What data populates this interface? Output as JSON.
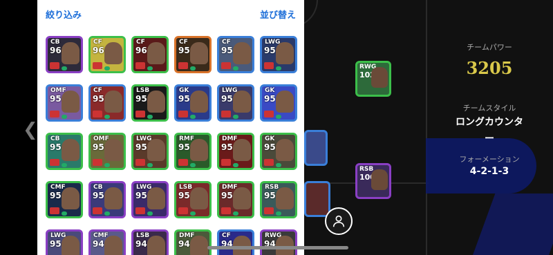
{
  "header": {
    "filter_label": "絞り込み",
    "sort_label": "並び替え"
  },
  "cards": [
    {
      "pos": "CB",
      "rating": "96",
      "border": "#8a3fc4",
      "bg": "#2d2a3a"
    },
    {
      "pos": "CF",
      "rating": "96",
      "border": "#3cbf4a",
      "bg": "#c4b43f"
    },
    {
      "pos": "CF",
      "rating": "96",
      "border": "#3cbf4a",
      "bg": "#5a1a1a"
    },
    {
      "pos": "CF",
      "rating": "95",
      "border": "#d9732a",
      "bg": "#3a2a1a"
    },
    {
      "pos": "CF",
      "rating": "95",
      "border": "#3a7fd9",
      "bg": "#4a5a7a"
    },
    {
      "pos": "LWG",
      "rating": "95",
      "border": "#3a7fd9",
      "bg": "#2a3a6a"
    },
    {
      "pos": "OMF",
      "rating": "95",
      "border": "#3a7fd9",
      "bg": "#7a5aa0"
    },
    {
      "pos": "CF",
      "rating": "95",
      "border": "#3a7fd9",
      "bg": "#8a2a2a"
    },
    {
      "pos": "LSB",
      "rating": "95",
      "border": "#3cbf4a",
      "bg": "#1a1a1a"
    },
    {
      "pos": "GK",
      "rating": "95",
      "border": "#3a7fd9",
      "bg": "#2a3a8a"
    },
    {
      "pos": "LWG",
      "rating": "95",
      "border": "#3a7fd9",
      "bg": "#3a3a6a"
    },
    {
      "pos": "GK",
      "rating": "95",
      "border": "#3a7fd9",
      "bg": "#3a4ac4"
    },
    {
      "pos": "CB",
      "rating": "95",
      "border": "#3cbf4a",
      "bg": "#2a7a6a"
    },
    {
      "pos": "OMF",
      "rating": "95",
      "border": "#3cbf4a",
      "bg": "#6a6a3a"
    },
    {
      "pos": "LWG",
      "rating": "95",
      "border": "#3cbf4a",
      "bg": "#5a3a2a"
    },
    {
      "pos": "RMF",
      "rating": "95",
      "border": "#3cbf4a",
      "bg": "#2a5a2a"
    },
    {
      "pos": "DMF",
      "rating": "95",
      "border": "#3cbf4a",
      "bg": "#6a1a1a"
    },
    {
      "pos": "GK",
      "rating": "95",
      "border": "#3cbf4a",
      "bg": "#4a4a3a"
    },
    {
      "pos": "CMF",
      "rating": "95",
      "border": "#3cbf4a",
      "bg": "#1a2a4a"
    },
    {
      "pos": "CB",
      "rating": "95",
      "border": "#8a3fc4",
      "bg": "#3a3a7a"
    },
    {
      "pos": "LWG",
      "rating": "95",
      "border": "#8a3fc4",
      "bg": "#3a2a6a"
    },
    {
      "pos": "LSB",
      "rating": "95",
      "border": "#3cbf4a",
      "bg": "#7a2a2a"
    },
    {
      "pos": "DMF",
      "rating": "95",
      "border": "#3cbf4a",
      "bg": "#6a2a2a"
    },
    {
      "pos": "RSB",
      "rating": "95",
      "border": "#3cbf4a",
      "bg": "#3a5a5a"
    },
    {
      "pos": "LWG",
      "rating": "95",
      "border": "#8a3fc4",
      "bg": "#4a4a7a"
    },
    {
      "pos": "CMF",
      "rating": "94",
      "border": "#8a3fc4",
      "bg": "#5a5a8a"
    },
    {
      "pos": "LSB",
      "rating": "94",
      "border": "#8a3fc4",
      "bg": "#3a2a4a"
    },
    {
      "pos": "DMF",
      "rating": "94",
      "border": "#3cbf4a",
      "bg": "#4a5a3a"
    },
    {
      "pos": "CF",
      "rating": "94",
      "border": "#3a7fd9",
      "bg": "#2a2a8a"
    },
    {
      "pos": "RWG",
      "rating": "94",
      "border": "#8a3fc4",
      "bg": "#3a3a3a"
    }
  ],
  "team": {
    "power_label": "チームパワー",
    "power_value": "3205",
    "style_label": "チームスタイル",
    "style_value": "ロングカウンタ",
    "style_dash": "ー",
    "formation_label": "フォーメーション",
    "formation_value": "4-2-1-3"
  },
  "pitch_cards": [
    {
      "pos": "RWG",
      "rating": "102"
    },
    {
      "pos": "RSB",
      "rating": "100"
    }
  ],
  "colors": {
    "accent": "#1e6fd9",
    "power": "#d9c84a"
  }
}
